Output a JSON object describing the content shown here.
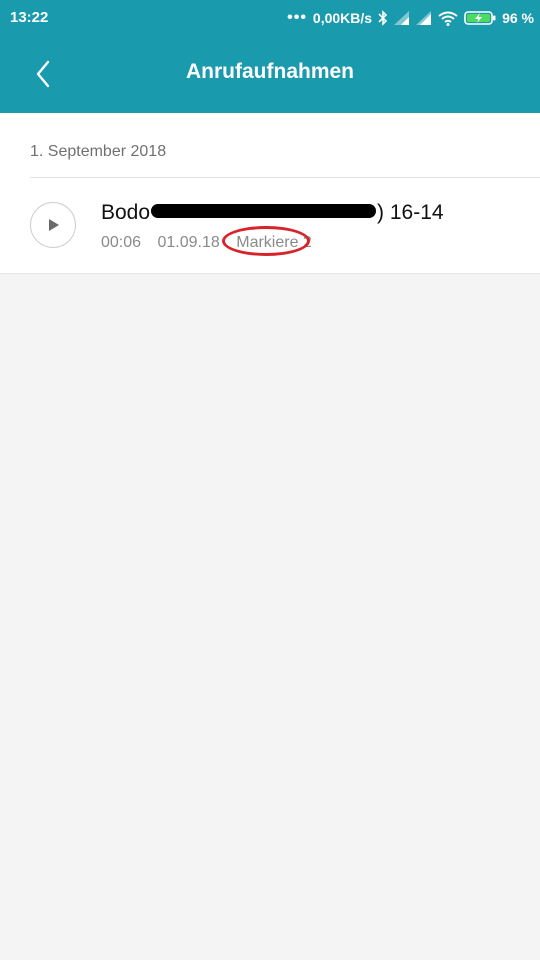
{
  "status_bar": {
    "time": "13:22",
    "network_speed": "0,00KB/s",
    "battery": "96 %",
    "icons": [
      "more-dots-icon",
      "bluetooth-icon",
      "signal-icon",
      "signal-icon",
      "wifi-icon",
      "battery-charging-icon"
    ]
  },
  "header": {
    "back_icon": "chevron-left-icon",
    "title": "Anrufaufnahmen"
  },
  "sections": [
    {
      "date": "1. September 2018",
      "recordings": [
        {
          "title_prefix": "Bodo",
          "title_suffix": ") 16-14",
          "duration": "00:06",
          "date": "01.09.18",
          "tag": "Markiere 2"
        }
      ]
    }
  ],
  "colors": {
    "accent": "#1a9aad",
    "annotation": "#d8232a"
  }
}
